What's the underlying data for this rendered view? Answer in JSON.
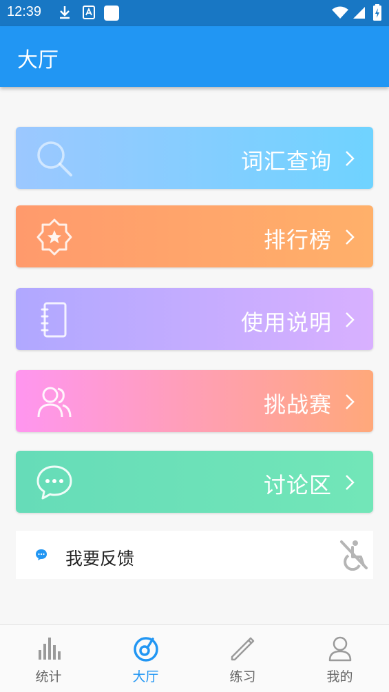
{
  "status_bar": {
    "time": "12:39",
    "icons": [
      "download-icon",
      "a-icon",
      "square-icon",
      "wifi-icon",
      "signal-icon",
      "battery-icon"
    ]
  },
  "app_bar": {
    "title": "大厅"
  },
  "cards": [
    {
      "label": "词汇查询",
      "icon": "search-icon"
    },
    {
      "label": "排行榜",
      "icon": "star-badge-icon"
    },
    {
      "label": "使用说明",
      "icon": "notebook-icon"
    },
    {
      "label": "挑战赛",
      "icon": "users-icon"
    },
    {
      "label": "讨论区",
      "icon": "chat-icon"
    }
  ],
  "feedback": {
    "label": "我要反馈",
    "icon": "chat-bubble-icon",
    "side_icon": "accessibility-icon"
  },
  "bottom_nav": {
    "items": [
      {
        "label": "统计",
        "icon": "bar-chart-icon"
      },
      {
        "label": "大厅",
        "icon": "hall-icon"
      },
      {
        "label": "练习",
        "icon": "pencil-icon"
      },
      {
        "label": "我的",
        "icon": "person-icon"
      }
    ],
    "active": "大厅"
  },
  "colors": {
    "status_bar": "#1877c4",
    "app_bar": "#2196f3",
    "active_nav": "#2196f3",
    "inactive_nav": "#999999",
    "card_search": [
      "#9cc8ff",
      "#6fd3ff"
    ],
    "card_rank": [
      "#ff9a6c",
      "#ffb06a"
    ],
    "card_manual": [
      "#b0a8ff",
      "#d8b0ff"
    ],
    "card_challenge": [
      "#ff96f0",
      "#ffa87a"
    ],
    "card_forum": [
      "#66dcb8",
      "#72e6b8"
    ]
  }
}
